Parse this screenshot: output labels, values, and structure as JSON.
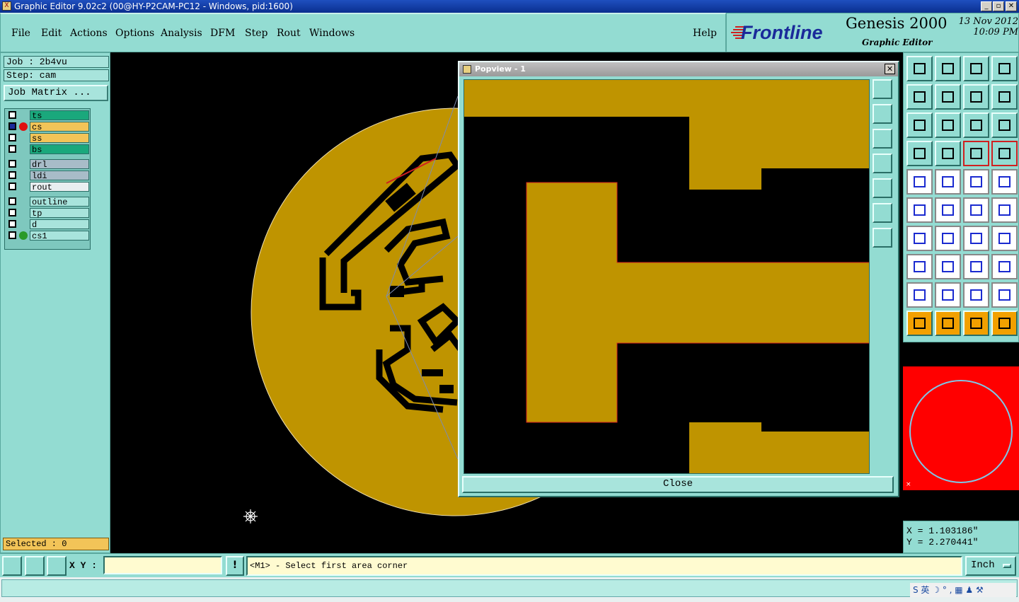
{
  "window": {
    "title": "Graphic Editor 9.02c2 (00@HY-P2CAM-PC12 - Windows, pid:1600)"
  },
  "menu": {
    "items": [
      "File",
      "Edit",
      "Actions",
      "Options",
      "Analysis",
      "DFM",
      "Step",
      "Rout",
      "Windows"
    ],
    "help": "Help"
  },
  "brand": {
    "logo": "Frontline",
    "product": "Genesis 2000",
    "subtitle": "Graphic Editor",
    "date": "13 Nov 2012",
    "time": "10:09 PM"
  },
  "job": {
    "job_label": "Job : 2b4vu",
    "step_label": "Step: cam",
    "matrix_button": "Job Matrix ..."
  },
  "layers": [
    {
      "name": "ts",
      "color": "#1aa87c",
      "checked": false,
      "dot": ""
    },
    {
      "name": "cs",
      "color": "#f2c458",
      "checked": true,
      "dot": "#e01010"
    },
    {
      "name": "ss",
      "color": "#f2c458",
      "checked": false,
      "dot": ""
    },
    {
      "name": "bs",
      "color": "#1aa87c",
      "checked": false,
      "dot": ""
    },
    {
      "name": "drl",
      "color": "#a8bcc8",
      "checked": false,
      "dot": ""
    },
    {
      "name": "ldi",
      "color": "#a8bcc8",
      "checked": false,
      "dot": ""
    },
    {
      "name": "rout",
      "color": "#e8eef0",
      "checked": false,
      "dot": ""
    },
    {
      "name": "outline",
      "color": "#a8e4dc",
      "checked": false,
      "dot": ""
    },
    {
      "name": "tp",
      "color": "#a8e4dc",
      "checked": false,
      "dot": ""
    },
    {
      "name": "d",
      "color": "#a8e4dc",
      "checked": false,
      "dot": ""
    },
    {
      "name": "cs1",
      "color": "#a8e4dc",
      "checked": false,
      "dot": "#2a9a2a"
    }
  ],
  "selected": "Selected : 0",
  "popview": {
    "title": "Popview - 1",
    "close_label": "Close"
  },
  "coords": {
    "x": "X = 1.103186\"",
    "y": "Y = 2.270441\""
  },
  "bottom": {
    "xy_label": "X Y :",
    "xy_value": "",
    "excl": "!",
    "prompt": "<M1> - Select first area corner",
    "units": "Inch"
  },
  "colors": {
    "copper": "#bf9400",
    "panel": "#93dcd2",
    "board_bg": "#000000"
  },
  "ime": {
    "text": "S 英 ☽ ° , ▦ ♟ ⚒"
  }
}
